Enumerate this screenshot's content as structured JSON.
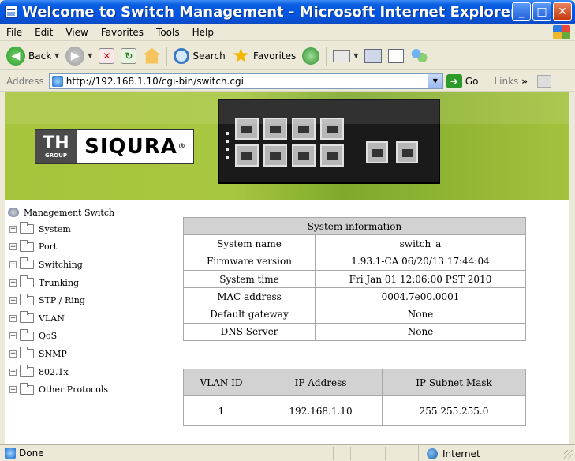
{
  "window": {
    "title": "Welcome to Switch Management - Microsoft Internet Explorer"
  },
  "menu": {
    "items": [
      "File",
      "Edit",
      "View",
      "Favorites",
      "Tools",
      "Help"
    ]
  },
  "toolbar": {
    "back_label": "Back",
    "search_label": "Search",
    "favorites_label": "Favorites"
  },
  "address": {
    "label": "Address",
    "url": "http://192.168.1.10/cgi-bin/switch.cgi",
    "go_label": "Go",
    "links_label": "Links"
  },
  "banner": {
    "logo_th": "TH",
    "logo_group": "GROUP",
    "logo_brand": "SIQURA",
    "logo_reg": "®"
  },
  "tree": {
    "root_label": "Management Switch",
    "items": [
      "System",
      "Port",
      "Switching",
      "Trunking",
      "STP / Ring",
      "VLAN",
      "QoS",
      "SNMP",
      "802.1x",
      "Other Protocols"
    ]
  },
  "system_info": {
    "header": "System information",
    "rows": [
      {
        "label": "System name",
        "value": "switch_a"
      },
      {
        "label": "Firmware version",
        "value": "1.93.1-CA 06/20/13 17:44:04"
      },
      {
        "label": "System time",
        "value": "Fri Jan 01 12:06:00 PST 2010"
      },
      {
        "label": "MAC address",
        "value": "0004.7e00.0001"
      },
      {
        "label": "Default gateway",
        "value": "None"
      },
      {
        "label": "DNS Server",
        "value": "None"
      }
    ]
  },
  "ip_table": {
    "headers": [
      "VLAN ID",
      "IP Address",
      "IP Subnet Mask"
    ],
    "rows": [
      [
        "1",
        "192.168.1.10",
        "255.255.255.0"
      ]
    ]
  },
  "status": {
    "text": "Done",
    "zone": "Internet"
  },
  "colors": {
    "banner_green": "#a6c43c",
    "titlebar_blue": "#0055e5"
  }
}
